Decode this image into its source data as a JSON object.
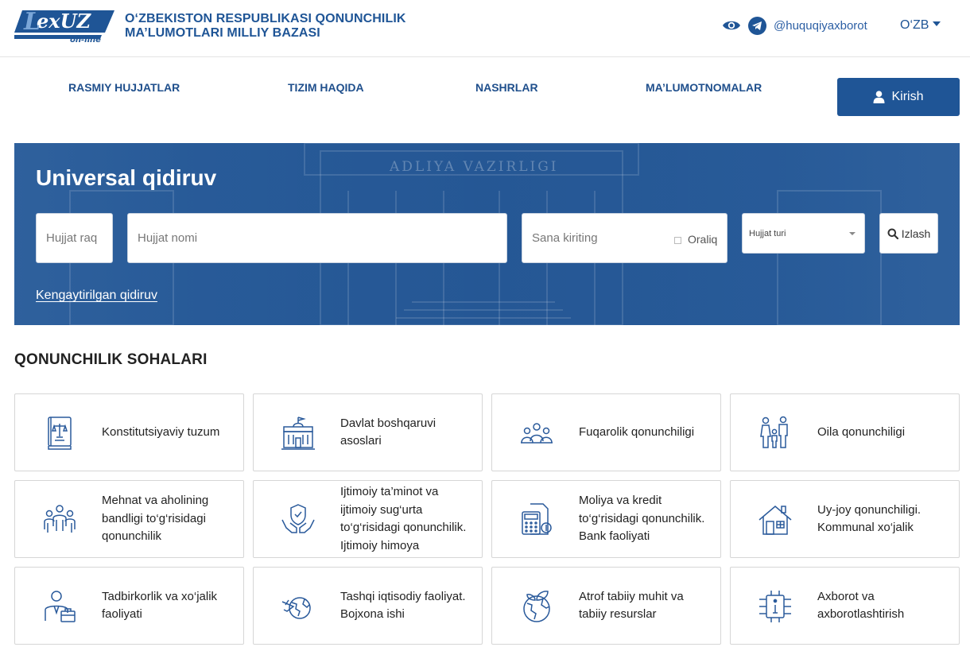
{
  "header": {
    "logo_text": "LexUZ on-line",
    "title_line1": "O‘ZBEKISTON RESPUBLIKASI QONUNCHILIK",
    "title_line2": "MA’LUMOTLARI MILLIY BAZASI",
    "telegram_handle": "@huquqiyaxborot",
    "language": "O‘ZB"
  },
  "nav": {
    "items": [
      "RASMIY HUJJATLAR",
      "TIZIM HAQIDA",
      "NASHRLAR",
      "MA’LUMOTNOMALAR"
    ],
    "login_label": "Kirish"
  },
  "search": {
    "title": "Universal qidiruv",
    "doc_number_placeholder": "Hujjat raq",
    "doc_name_placeholder": "Hujjat nomi",
    "date_placeholder": "Sana kiriting",
    "range_label": "Oraliq",
    "doc_type_label": "Hujjat turi",
    "search_button": "Izlash",
    "advanced_link": "Kengaytirilgan qidiruv",
    "background_sign": "ADLIYA VAZIRLIGI"
  },
  "sections": {
    "title": "QONUNCHILIK SOHALARI",
    "items": [
      {
        "label": "Konstitutsiyaviy tuzum",
        "icon": "constitution-book-icon"
      },
      {
        "label": "Davlat boshqaruvi asoslari",
        "icon": "government-building-icon"
      },
      {
        "label": "Fuqarolik qonunchiligi",
        "icon": "citizens-group-icon"
      },
      {
        "label": "Oila qonunchiligi",
        "icon": "family-icon"
      },
      {
        "label": "Mehnat va aholining bandligi to‘g‘risidagi qonunchilik",
        "icon": "workers-group-icon"
      },
      {
        "label": "Ijtimoiy ta’minot va ijtimoiy sug‘urta to‘g‘risidagi qonunchilik. Ijtimoiy himoya",
        "icon": "shield-hands-icon"
      },
      {
        "label": "Moliya va kredit to‘g‘risidagi qonunchilik. Bank faoliyati",
        "icon": "finance-calculator-icon"
      },
      {
        "label": "Uy-joy qonunchiligi. Kommunal xo‘jalik",
        "icon": "house-icon"
      },
      {
        "label": "Tadbirkorlik va xo‘jalik faoliyati",
        "icon": "businessman-icon"
      },
      {
        "label": "Tashqi iqtisodiy faoliyat. Bojxona ishi",
        "icon": "globe-plane-icon"
      },
      {
        "label": "Atrof tabiiy muhit va tabiiy resurslar",
        "icon": "earth-leaves-icon"
      },
      {
        "label": "Axborot va axborotlashtirish",
        "icon": "information-chip-icon"
      }
    ]
  },
  "colors": {
    "brand_blue": "#1f5596",
    "link_blue": "#2c5fa4",
    "icon_blue": "#2a5a9b"
  }
}
